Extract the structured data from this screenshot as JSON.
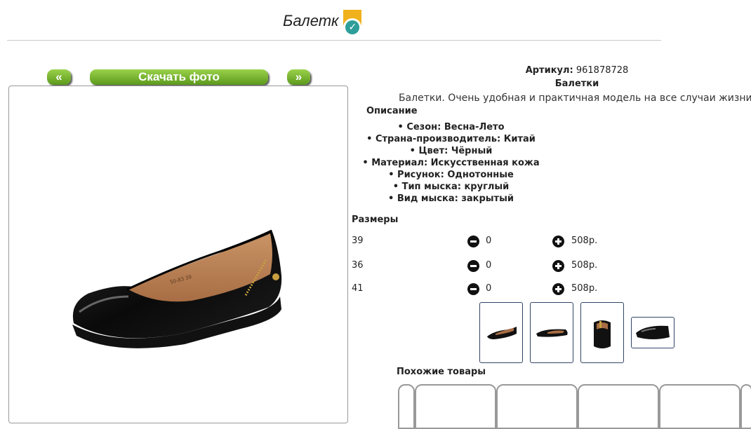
{
  "header": {
    "title": "Балетк"
  },
  "gallery": {
    "prev_label": "«",
    "download_label": "Скачать фото",
    "next_label": "»"
  },
  "product": {
    "article_label": "Артикул:",
    "article_value": "961878728",
    "name": "Балетки",
    "description": "Балетки. Очень удобная и практичная модель на все случаи жизни.",
    "description_heading": "Описание",
    "properties": [
      "Сезон: Весна-Лето",
      "Страна-производитель: Китай",
      "Цвет: Чёрный",
      "Материал: Искусственная кожа",
      "Рисунок: Однотонные",
      "Тип мыска: круглый",
      "Вид мыска: закрытый"
    ]
  },
  "sizes": {
    "title": "Размеры",
    "rows": [
      {
        "size": "39",
        "qty": "0",
        "price": "508р."
      },
      {
        "size": "36",
        "qty": "0",
        "price": "508р."
      },
      {
        "size": "41",
        "qty": "0",
        "price": "508р."
      }
    ]
  },
  "similar": {
    "title": "Похожие товары"
  },
  "colors": {
    "accent_green": "#6aa828",
    "badge_yellow": "#f0b21c",
    "badge_teal": "#2f9e9a"
  }
}
